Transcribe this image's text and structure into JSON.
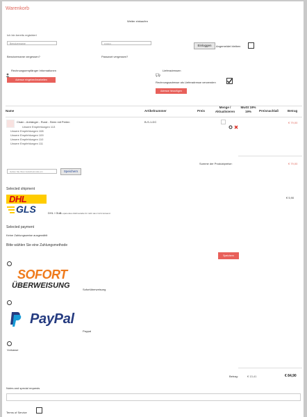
{
  "cart": {
    "title": "Warenkorb",
    "continue_shopping": "Weiter einkaufen",
    "login": {
      "registered_text": "Ich bin bereits registriert",
      "username_placeholder": "Benutzername",
      "password_placeholder": "••••••••",
      "login_button": "Einloggen",
      "stay_logged_in": "Angemeldet bleiben",
      "forgot_username": "Benutzername vergessen?",
      "forgot_password": "Passwort vergessen?"
    },
    "addresses": {
      "billing_heading": "Rechnungsempfänger Informationen",
      "billing_button": "Adresse eingeben/bearbeiten",
      "shipping_heading": "Lieferadressen",
      "use_billing_as_shipping": "Rechnungsadresse als Lieferadresse verwenden",
      "add_address_button": "Adresse hinzufügen"
    },
    "table": {
      "headers": {
        "name": "Name",
        "sku": "Artikelnummer",
        "price": "Preis",
        "qty": "Menge / Aktualisieren",
        "tax": "MwSt 19% 19%",
        "discount": "Preisnachlaß",
        "total": "Betrag"
      },
      "row": {
        "name": "Chain - Anhänger - Rund - Stern mit Perlen",
        "recipients": [
          "Unsere Empfehlungen 113",
          "Unsere Empfehlungen 108",
          "Unsere Empfehlungen 109",
          "Unsere Empfehlungen 110",
          "Unsere Empfehlungen 111"
        ],
        "sku": "B-S-1-DC",
        "total": "€ 79,00"
      },
      "subtotal_label": "Summe der Produktpreise:",
      "subtotal_value": "€ 79,00"
    },
    "coupon": {
      "placeholder": "Geben Sie Ihren Gutscheincode ein",
      "save_button": "Speichern"
    },
    "shipment": {
      "heading": "Selected shipment",
      "dhl_logo": "DHL",
      "gls_logo": "GLS",
      "carrier_label": "DHL / GLS",
      "carrier_note": "Ein-sparendes Zahlmodelle für nicht dem GLS-Versand",
      "cost": "€ 5,90"
    },
    "payment": {
      "heading": "Selected payment",
      "none_selected": "Keine Zahlungsweise ausgewählt",
      "choose_text": "Bitte wählen Sie eine Zahlungsmethode",
      "save_button": "Speichern",
      "sofort_line1": "SOFORT",
      "sofort_line2": "ÜBERWEISUNG",
      "sofort_label": "Sofortüberweisung",
      "paypal_logo": "PayPal",
      "paypal_label": "Paypal",
      "vorkasse_label": "Vorkasse"
    },
    "totals": {
      "label": "Betrag:",
      "tax": "€ 13,41",
      "total": "€ 84,90"
    },
    "notes": {
      "label": "Notes and special requests"
    },
    "terms": {
      "label": "Terms of Service"
    }
  },
  "colors": {
    "accent": "#e0675c",
    "button_red": "#e8605a",
    "paypal_dark": "#253b80",
    "paypal_light": "#179bd7",
    "sofort_orange": "#ef7a1b",
    "dhl_yellow": "#ffcc00",
    "dhl_red": "#d40511"
  }
}
